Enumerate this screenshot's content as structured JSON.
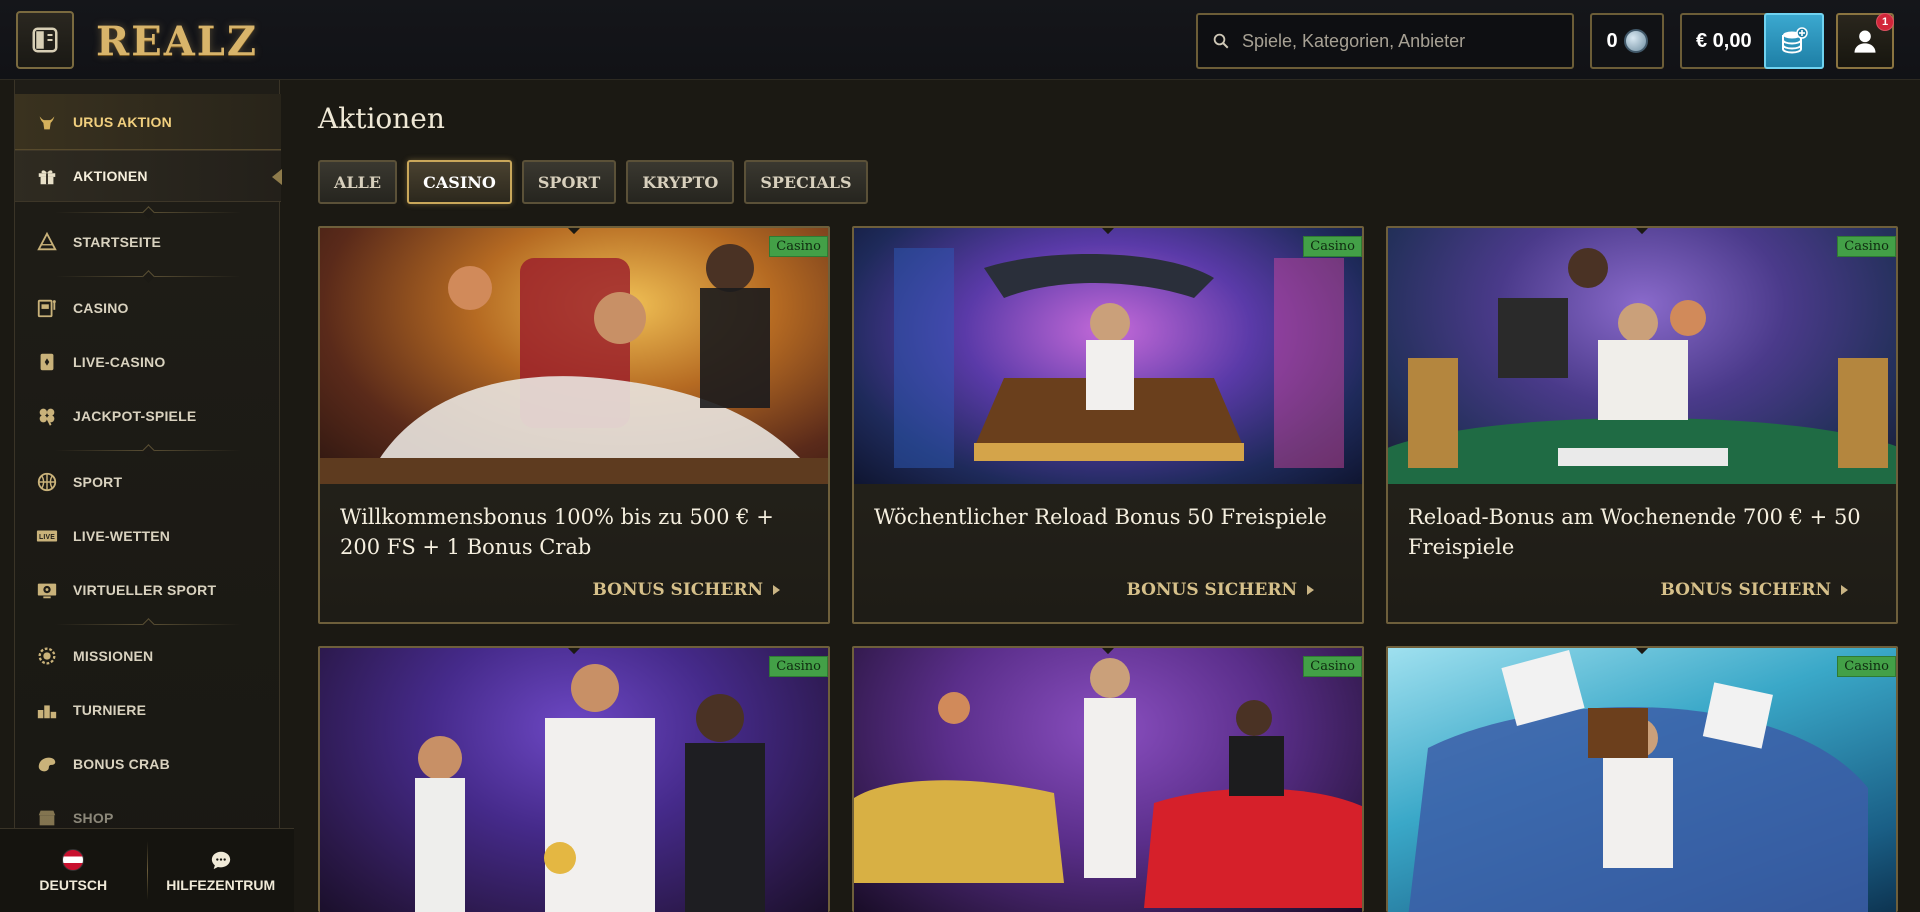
{
  "header": {
    "logo_text": "REALZ",
    "search_placeholder": "Spiele, Kategorien, Anbieter",
    "coins_value": "0",
    "balance": "€ 0,00",
    "notification_count": "1"
  },
  "sidebar": {
    "items": [
      {
        "label": "URUS AKTION",
        "icon": "bull-icon"
      },
      {
        "label": "AKTIONEN",
        "icon": "gift-icon"
      },
      {
        "label": "STARTSEITE",
        "icon": "pyramid-icon"
      },
      {
        "label": "CASINO",
        "icon": "slot-machine-icon"
      },
      {
        "label": "LIVE-CASINO",
        "icon": "playing-card-icon"
      },
      {
        "label": "JACKPOT-SPIELE",
        "icon": "clover-icon"
      },
      {
        "label": "SPORT",
        "icon": "basketball-icon"
      },
      {
        "label": "LIVE-WETTEN",
        "icon": "live-badge-icon"
      },
      {
        "label": "VIRTUELLER SPORT",
        "icon": "virtual-sport-icon"
      },
      {
        "label": "MISSIONEN",
        "icon": "mission-medal-icon"
      },
      {
        "label": "TURNIERE",
        "icon": "podium-icon"
      },
      {
        "label": "BONUS CRAB",
        "icon": "crab-icon"
      },
      {
        "label": "SHOP",
        "icon": "shop-icon"
      }
    ],
    "footer": {
      "language_label": "DEUTSCH",
      "help_label": "HILFEZENTRUM"
    }
  },
  "main": {
    "title": "Aktionen",
    "filters": [
      "ALLE",
      "CASINO",
      "SPORT",
      "KRYPTO",
      "SPECIALS"
    ],
    "active_filter": "CASINO",
    "cards": [
      {
        "tag": "Casino",
        "title": "Willkommensbonus 100% bis zu 500 € + 200 FS + 1 Bonus Crab",
        "cta": "BONUS SICHERN"
      },
      {
        "tag": "Casino",
        "title": "Wöchentlicher Reload Bonus 50 Freispiele",
        "cta": "BONUS SICHERN"
      },
      {
        "tag": "Casino",
        "title": "Reload-Bonus am Wochenende 700 € + 50 Freispiele",
        "cta": "BONUS SICHERN"
      },
      {
        "tag": "Casino",
        "title": "",
        "cta": ""
      },
      {
        "tag": "Casino",
        "title": "",
        "cta": ""
      },
      {
        "tag": "Casino",
        "title": "",
        "cta": ""
      }
    ]
  },
  "colors": {
    "accent_gold": "#c9a75a",
    "tag_green": "#43a047",
    "deposit_blue": "#2a95bd"
  }
}
